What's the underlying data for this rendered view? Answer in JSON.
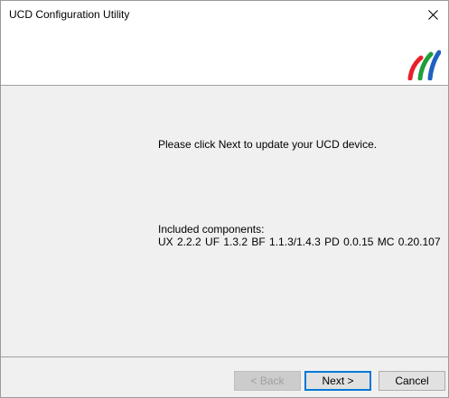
{
  "window": {
    "title": "UCD Configuration Utility",
    "close_icon": "close-icon"
  },
  "header": {
    "logo_icon": "ucd-logo-icon",
    "logo_colors": [
      "#e8202a",
      "#1f9e3c",
      "#2060c0"
    ]
  },
  "main": {
    "prompt": "Please click Next to update your UCD device.",
    "components_label": "Included components:",
    "components": "UX 2.2.2   UF 1.3.2   BF 1.1.3/1.4.3   PD 0.0.15   MC 0.20.107"
  },
  "footer": {
    "back_label": "< Back",
    "next_label": "Next >",
    "cancel_label": "Cancel"
  },
  "colors": {
    "panel_bg": "#f0f0f0",
    "accent": "#0078d7",
    "disabled_text": "#a0a0a0"
  }
}
